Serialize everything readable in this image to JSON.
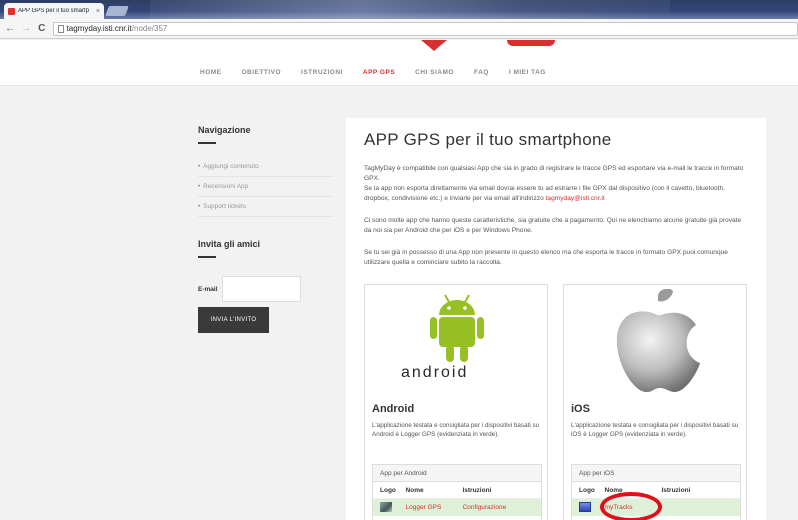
{
  "browser": {
    "tab_title": "APP GPS per il tuo smartp",
    "tab_close": "×",
    "url_host": "tagmyday.isti.cnr.it",
    "url_path": "/node/357",
    "back": "←",
    "forward": "→",
    "reload": "C"
  },
  "nav": {
    "items": [
      {
        "label": "HOME"
      },
      {
        "label": "OBIETTIVO"
      },
      {
        "label": "ISTRUZIONI"
      },
      {
        "label": "APP GPS"
      },
      {
        "label": "CHI SIAMO"
      },
      {
        "label": "FAQ"
      },
      {
        "label": "I MIEI TAG"
      }
    ],
    "active_index": 3
  },
  "sidebar": {
    "nav_heading": "Navigazione",
    "links": [
      {
        "label": "Aggiungi contenuto"
      },
      {
        "label": "Recensioni App"
      },
      {
        "label": "Support tickets"
      }
    ],
    "invite_heading": "Invita gli amici",
    "email_label": "E-mail",
    "email_value": "",
    "invite_button": "INVIA L'INVITO"
  },
  "main": {
    "title": "APP GPS per il tuo smartphone",
    "p1": "TagMyDay è compatibile con qualsiasi App che sia in grado di registrare le tracce GPS ed esportare via e-mail le tracce in formato GPX.",
    "p2a": "Se la app non esporta direttamente via email dovrai essere tu ad estrarre i file GPX dal dispositivo (con il cavetto, bluetooth, dropbox, condivisione etc.) e inviarle per via email all'indirizzo ",
    "p2_email": "tagmyday@isti.cnr.it",
    "p3": "Ci sono molte app che hanno queste caratteristiche, sia gratuite che a pagamento. Qui ne elenchiamo alcune gratuite già provate da noi sia per Android che per iOS e per Windows Phone.",
    "p4": "Se tu sei già in possesso di una App non presente in questo elenco ma che esporta le tracce in formato GPX puoi comunque utilizzare quella e cominciare subito la raccolta.",
    "android": {
      "wordmark": "android",
      "title": "Android",
      "desc": "L'applicazione testata e consigliata per i dispositivi basati su Android è Logger GPS (evidenziata in verde).",
      "box_title": "App per Android",
      "headers": [
        "Logo",
        "Nome",
        "Istruzioni"
      ],
      "row": {
        "name": "Logger GPS",
        "instructions": "Configurazione"
      }
    },
    "ios": {
      "title": "iOS",
      "desc": "L'applicazione testata e consigliata per i dispositivi basati su iOS è Logger GPS (evidenziata in verde).",
      "box_title": "App per iOS",
      "headers": [
        "Logo",
        "Nome",
        "Istruzioni"
      ],
      "row": {
        "name": "myTracks",
        "instructions": ""
      }
    }
  },
  "colors": {
    "accent": "#d8302e",
    "android_green": "#97c024",
    "highlight_row": "#dff0d8",
    "annotation": "#e0101a"
  }
}
